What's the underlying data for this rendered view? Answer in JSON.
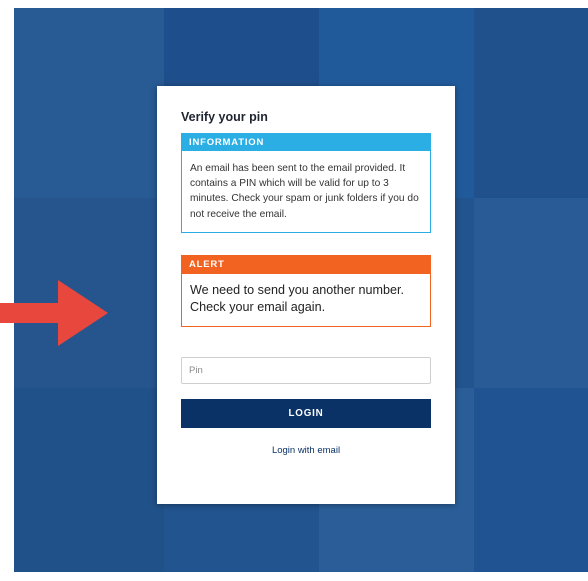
{
  "background": {
    "description_colors": {
      "base": "#2f5f93",
      "overlay": "#14468c"
    }
  },
  "pointer_arrow": {
    "color": "#e8473e",
    "icon": "arrow-right-icon"
  },
  "form": {
    "title": "Verify your pin",
    "information": {
      "heading": "INFORMATION",
      "text": "An email has been sent to the email provided. It contains a PIN which will be valid for up to 3 minutes. Check your spam or junk folders if you do not receive the email.",
      "color": "#2aaee4"
    },
    "alert": {
      "heading": "ALERT",
      "text": "We need to send you another number. Check your email again.",
      "color": "#f26322"
    },
    "pin_field": {
      "placeholder": "Pin",
      "value": ""
    },
    "login_button": {
      "label": "LOGIN",
      "color": "#0b3266"
    },
    "email_login_link": "Login with email"
  }
}
